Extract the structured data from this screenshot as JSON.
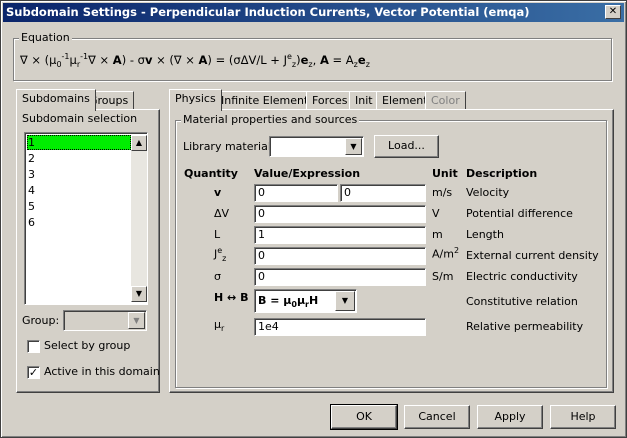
{
  "window": {
    "title": "Subdomain Settings - Perpendicular Induction Currents, Vector Potential (emqa)",
    "close_glyph": "✕"
  },
  "equation": {
    "label": "Equation",
    "text": "∇ × (μ0-1μr-1∇ × A) - σv × (∇ × A) = (σΔV/L + Jez)ez, A = Azez"
  },
  "left_tabs": [
    "Subdomains",
    "Groups"
  ],
  "subdomain_selection": {
    "label": "Subdomain selection",
    "items": [
      "1",
      "2",
      "3",
      "4",
      "5",
      "6"
    ],
    "selected": "1"
  },
  "group": {
    "label": "Group:",
    "value": ""
  },
  "select_by_group": {
    "label": "Select by group",
    "checked": false
  },
  "active_in_domain": {
    "label": "Active in this domain",
    "checked": true
  },
  "right_tabs": [
    "Physics",
    "Infinite Elements",
    "Forces",
    "Init",
    "Element",
    "Color"
  ],
  "material": {
    "section_label": "Material properties and sources",
    "library_label": "Library material:",
    "library_value": "",
    "load_label": "Load..."
  },
  "table": {
    "headers": {
      "quantity": "Quantity",
      "value": "Value/Expression",
      "unit": "Unit",
      "description": "Description"
    },
    "rows": [
      {
        "quantity": "v",
        "value": "0",
        "value2": "0",
        "unit": "m/s",
        "description": "Velocity"
      },
      {
        "quantity": "ΔV",
        "value": "0",
        "unit": "V",
        "description": "Potential difference"
      },
      {
        "quantity": "L",
        "value": "1",
        "unit": "m",
        "description": "Length"
      },
      {
        "quantity": "Jez",
        "value": "0",
        "unit": "A/m2",
        "description": "External current density"
      },
      {
        "quantity": "σ",
        "value": "0",
        "unit": "S/m",
        "description": "Electric conductivity"
      },
      {
        "quantity": "H ↔ B",
        "value": "B = μ0μrH",
        "unit": "",
        "description": "Constitutive relation"
      },
      {
        "quantity": "μr",
        "value": "1e4",
        "unit": "",
        "description": "Relative permeability"
      }
    ]
  },
  "buttons": {
    "ok": "OK",
    "cancel": "Cancel",
    "apply": "Apply",
    "help": "Help"
  },
  "icons": {
    "dropdown_arrow": "▼",
    "scroll_up": "▲",
    "scroll_down": "▼",
    "check": "✓"
  },
  "colors": {
    "title_gradient_start": "#0a246a",
    "title_gradient_end": "#3a6ea5",
    "selection_highlight": "#00ee00",
    "dialog_face": "#d4d0c8"
  }
}
